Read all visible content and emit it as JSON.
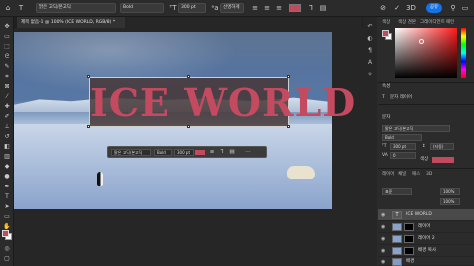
{
  "options_bar": {
    "font_family": "맑은 고딕/본고딕",
    "font_style": "Bold",
    "font_size": "300 pt",
    "anti_alias": "선명하게",
    "share_label": "공유",
    "text_color": "#c24a5e"
  },
  "document_tab": {
    "title": "제목 없음-1 @ 100% (ICE WORLD, RGB/8) *"
  },
  "canvas": {
    "headline_text": "ICE WORLD",
    "text_color": "#c44a60"
  },
  "contextual_bar": {
    "font_family": "맑은 고딕/본고딕",
    "font_style": "Bold",
    "font_size": "300 pt"
  },
  "panels": {
    "tabs": [
      "색상",
      "색상 견본",
      "그레이디언트",
      "패턴"
    ],
    "properties_title": "속성",
    "layer_kind": "문자 레이어",
    "character_title": "문자",
    "font_family": "맑은 고딕/본고딕",
    "font_style": "Bold",
    "font_size": "300 pt",
    "leading": "(자동)",
    "tracking": "0",
    "color_label": "색상",
    "layers_tabs": [
      "레이어",
      "채널",
      "패스",
      "3D"
    ],
    "blend_mode": "표준",
    "opacity": "100%",
    "fill": "100%"
  },
  "layers": [
    {
      "name": "ICE WORLD",
      "type": "text",
      "selected": true
    },
    {
      "name": "레이어",
      "type": "image",
      "selected": false
    },
    {
      "name": "레이어 2",
      "type": "image",
      "selected": false
    },
    {
      "name": "배경 복사",
      "type": "image",
      "selected": false
    },
    {
      "name": "배경",
      "type": "image",
      "selected": false
    }
  ],
  "colors": {
    "foreground": "#c24a5e",
    "background": "#ffffff"
  }
}
